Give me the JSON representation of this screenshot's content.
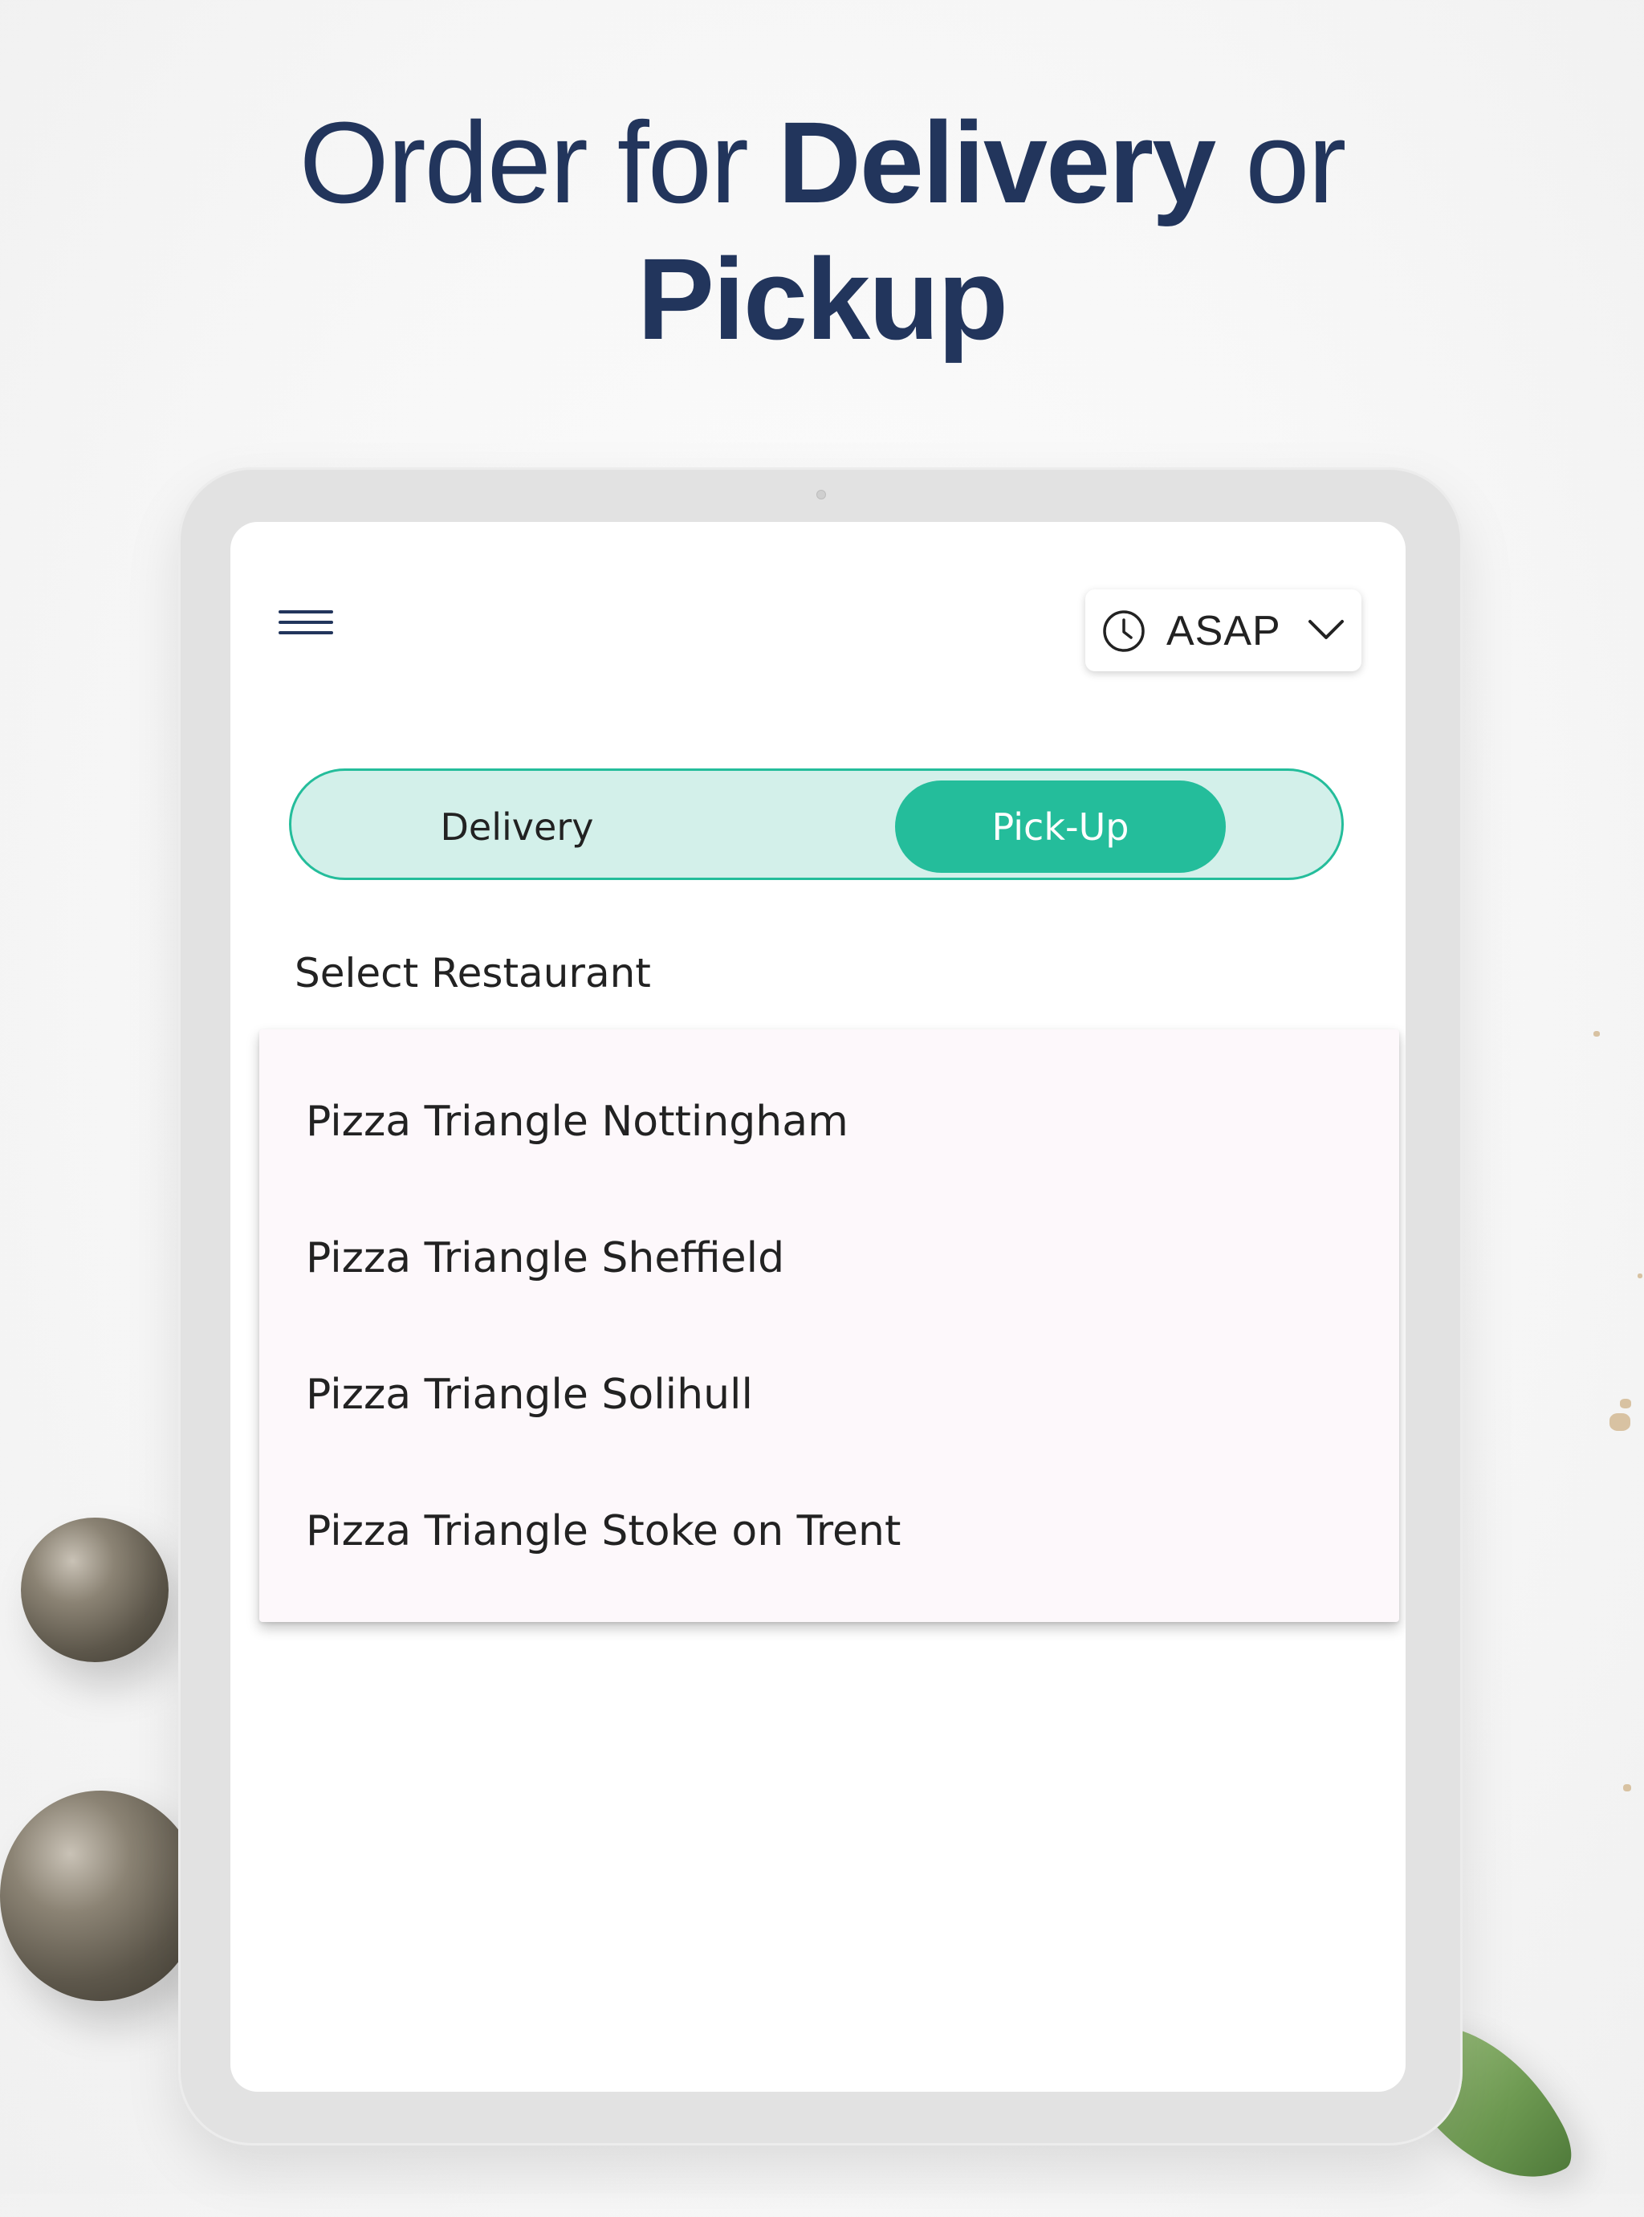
{
  "headline": {
    "line1_prefix": "Order for ",
    "line1_emphasis": "Delivery",
    "line1_suffix": " or",
    "line2_emphasis": "Pickup"
  },
  "header": {
    "menu_icon": "hamburger-menu-icon",
    "time_select": {
      "icon": "clock-icon",
      "value": "ASAP",
      "chevron": "chevron-down-icon"
    }
  },
  "order_mode": {
    "options": [
      {
        "label": "Delivery",
        "selected": false
      },
      {
        "label": "Pick-Up",
        "selected": true
      }
    ]
  },
  "restaurant_select": {
    "label": "Select Restaurant",
    "options": [
      "Pizza Triangle Nottingham",
      "Pizza Triangle Sheffield",
      "Pizza Triangle Solihull",
      "Pizza Triangle Stoke on Trent"
    ]
  },
  "colors": {
    "headline": "#22355c",
    "accent": "#24bd9b",
    "accent_light": "#d3f0ea",
    "text": "#222222",
    "dropdown_bg": "#fdf8fb",
    "device_bezel": "#e2e2e2"
  }
}
